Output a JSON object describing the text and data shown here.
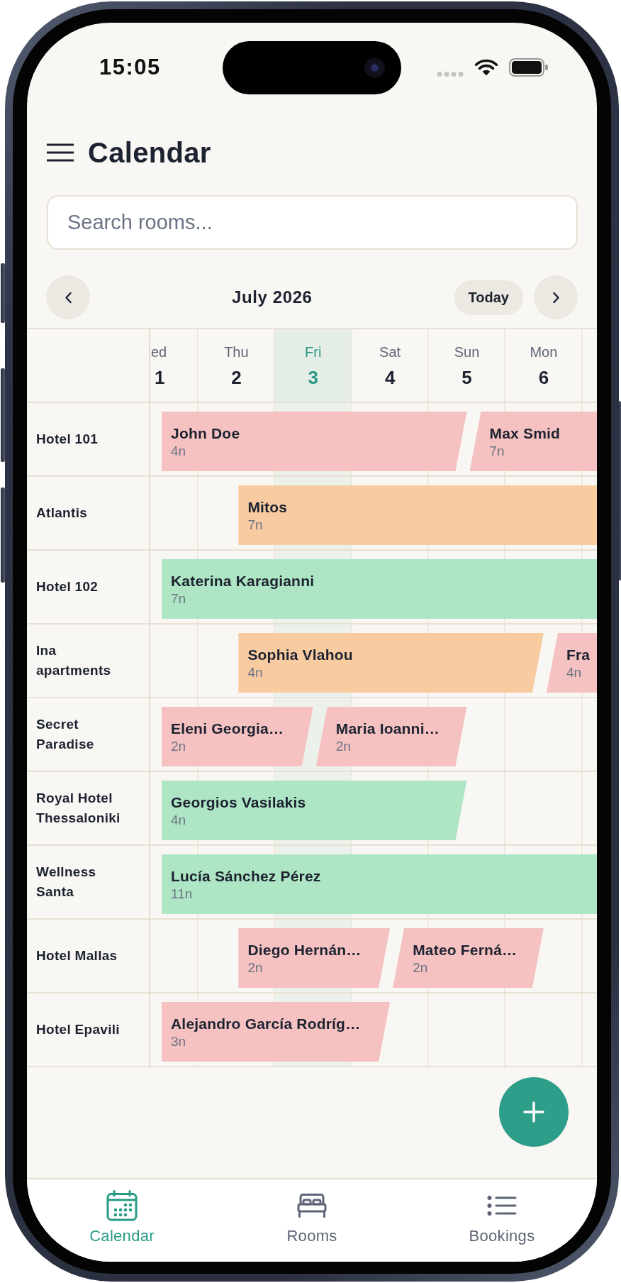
{
  "status_bar": {
    "time": "15:05"
  },
  "header": {
    "title": "Calendar"
  },
  "search": {
    "placeholder": "Search rooms..."
  },
  "month_nav": {
    "month": "July 2026",
    "today_button": "Today"
  },
  "days": [
    {
      "weekday": "ed",
      "date": "1",
      "today": false
    },
    {
      "weekday": "Thu",
      "date": "2",
      "today": false
    },
    {
      "weekday": "Fri",
      "date": "3",
      "today": true
    },
    {
      "weekday": "Sat",
      "date": "4",
      "today": false
    },
    {
      "weekday": "Sun",
      "date": "5",
      "today": false
    },
    {
      "weekday": "Mon",
      "date": "6",
      "today": false
    }
  ],
  "rooms": [
    {
      "name": "Hotel 101",
      "bookings": [
        {
          "guest": "John Doe",
          "nights": "4n",
          "color": "#f5c2c1"
        },
        {
          "guest": "Max Smid",
          "nights": "7n",
          "color": "#f5c2c1"
        }
      ]
    },
    {
      "name": "Atlantis",
      "bookings": [
        {
          "guest": "Mitos",
          "nights": "7n",
          "color": "#f8cba1"
        }
      ]
    },
    {
      "name": "Hotel 102",
      "bookings": [
        {
          "guest": "Katerina Karagianni",
          "nights": "7n",
          "color": "#aee5c4"
        }
      ]
    },
    {
      "name": "Ina apartments",
      "bookings": [
        {
          "guest": "Sophia Vlahou",
          "nights": "4n",
          "color": "#f8cba1"
        },
        {
          "guest": "Fra",
          "nights": "4n",
          "color": "#f5c2c1"
        }
      ]
    },
    {
      "name": "Secret Paradise",
      "bookings": [
        {
          "guest": "Eleni Georgia…",
          "nights": "2n",
          "color": "#f5c2c1"
        },
        {
          "guest": "Maria Ioanni…",
          "nights": "2n",
          "color": "#f5c2c1"
        }
      ]
    },
    {
      "name": "Royal Hotel Thessaloniki",
      "bookings": [
        {
          "guest": "Georgios Vasilakis",
          "nights": "4n",
          "color": "#aee5c4"
        }
      ]
    },
    {
      "name": "Wellness Santa",
      "bookings": [
        {
          "guest": "Lucía Sánchez Pérez",
          "nights": "11n",
          "color": "#aee5c4"
        }
      ]
    },
    {
      "name": "Hotel Mallas",
      "bookings": [
        {
          "guest": "Diego Hernán…",
          "nights": "2n",
          "color": "#f5c2c1"
        },
        {
          "guest": "Mateo Ferná…",
          "nights": "2n",
          "color": "#f5c2c1"
        }
      ]
    },
    {
      "name": "Hotel Epavili",
      "bookings": [
        {
          "guest": "Alejandro García Rodríg…",
          "nights": "3n",
          "color": "#f5c2c1"
        }
      ]
    }
  ],
  "tab_bar": [
    {
      "label": "Calendar",
      "selected": true
    },
    {
      "label": "Rooms",
      "selected": false
    },
    {
      "label": "Bookings",
      "selected": false
    }
  ]
}
